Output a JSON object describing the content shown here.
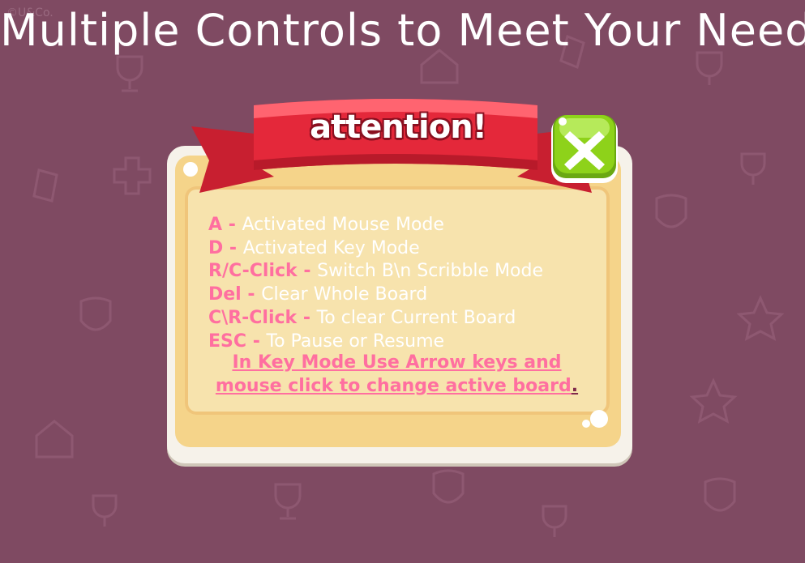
{
  "watermark": "©U&Co.",
  "headline": "Multiple Controls to Meet Your Needs",
  "dialog": {
    "ribbon_title": "attention!",
    "close_icon": "close-x-icon",
    "controls": [
      {
        "key": "A",
        "sep": " - ",
        "desc": "Activated Mouse Mode"
      },
      {
        "key": "D",
        "sep": " - ",
        "desc": "Activated Key Mode"
      },
      {
        "key": "R/C-Click",
        "sep": " - ",
        "desc": "Switch B\\n Scribble Mode"
      },
      {
        "key": "Del",
        "sep": " - ",
        "desc": "Clear Whole Board"
      },
      {
        "key": "C\\R-Click",
        "sep": " - ",
        "desc": "To clear Current Board"
      },
      {
        "key": "ESC",
        "sep": " - ",
        "desc": "To Pause or Resume"
      }
    ],
    "note_line1": "In Key Mode Use Arrow keys and ",
    "note_line2": " mouse click to change active board",
    "note_end": "."
  },
  "colors": {
    "background": "#7f4a62",
    "ribbon": "#e4283a",
    "key_text": "#ff6fa0",
    "close_button": "#8ed21a"
  }
}
